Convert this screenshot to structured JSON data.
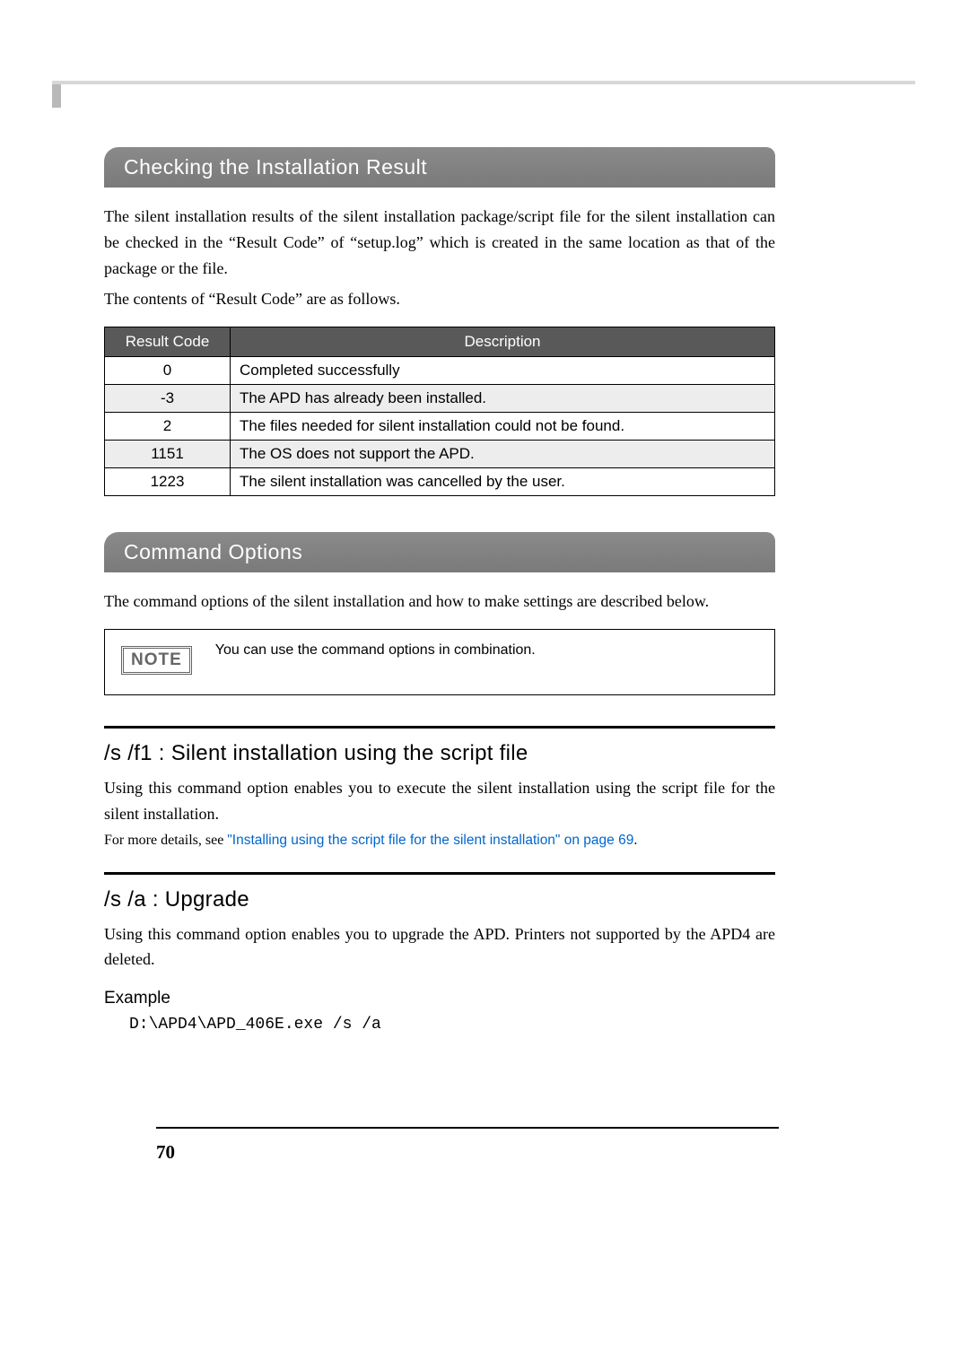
{
  "section1": {
    "title": "Checking the Installation Result",
    "para1": "The silent installation results of the silent installation package/script file for the silent installation can be checked in the “Result Code” of “setup.log” which is created in the same location as that of the package or the file.",
    "para2": "The contents of “Result Code” are as follows."
  },
  "codes_table": {
    "headers": {
      "c0": "Result Code",
      "c1": "Description"
    },
    "rows": [
      {
        "code": "0",
        "desc": "Completed successfully"
      },
      {
        "code": "-3",
        "desc": "The APD has already been installed."
      },
      {
        "code": "2",
        "desc": "The files needed for silent installation could not be found."
      },
      {
        "code": "1151",
        "desc": "The OS does not support the APD."
      },
      {
        "code": "1223",
        "desc": "The silent installation was cancelled by the user."
      }
    ]
  },
  "section2": {
    "title": "Command Options",
    "para1": "The command options of the silent installation and how to make settings are described below."
  },
  "note": {
    "badge": "NOTE",
    "text": "You can use the command options in combination."
  },
  "sub1": {
    "heading": "/s /f1 : Silent installation using the script file",
    "para": "Using this command option enables you to execute the silent installation using the script file for the silent installation.",
    "ref_prefix": "For more details, see ",
    "ref_link": "\"Installing using the script file for the silent installation\" on page 69",
    "ref_suffix": "."
  },
  "sub2": {
    "heading": "/s /a : Upgrade",
    "para": "Using this command option enables you to upgrade the APD. Printers not supported by the APD4 are deleted.",
    "example_label": "Example",
    "example_cmd": "D:\\APD4\\APD_406E.exe /s /a"
  },
  "page_number": "70"
}
